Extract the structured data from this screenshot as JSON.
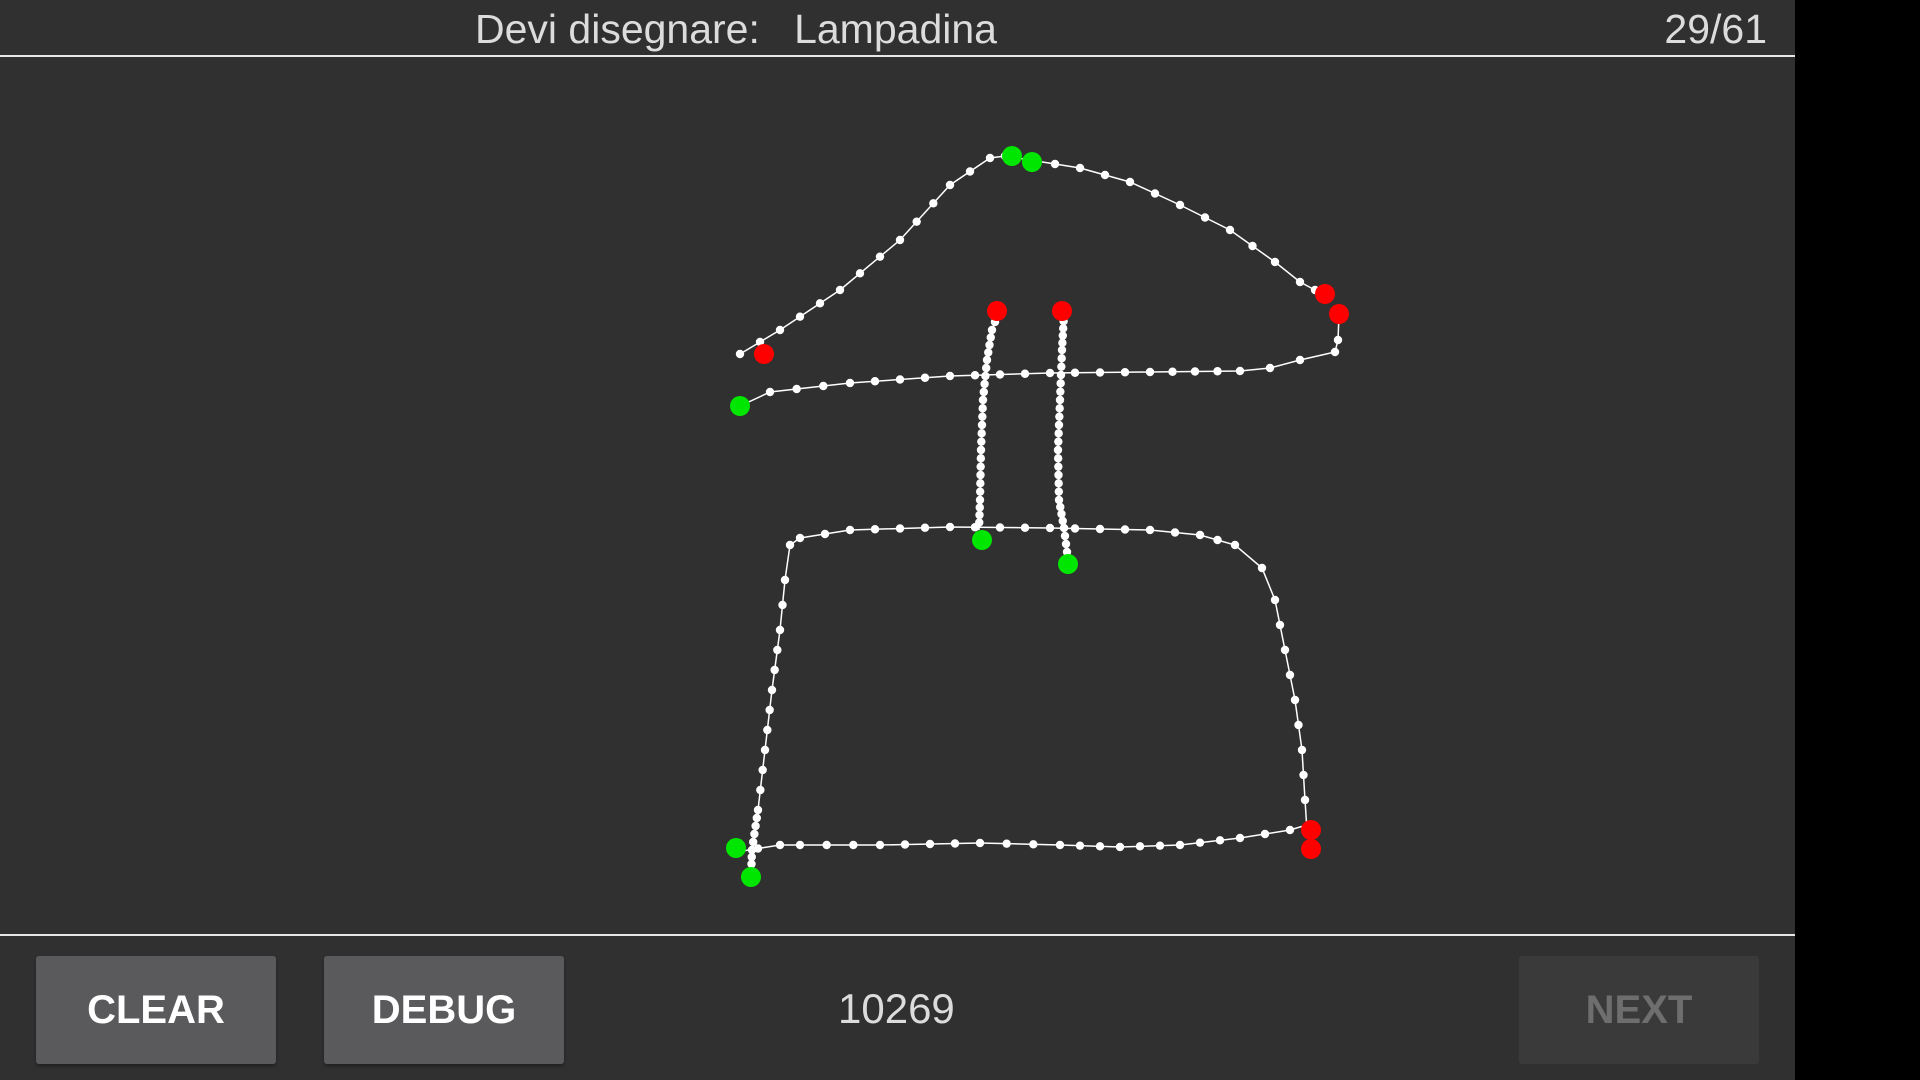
{
  "header": {
    "prompt_label": "Devi disegnare:",
    "prompt_word": "Lampadina",
    "progress": "29/61"
  },
  "footer": {
    "clear_label": "CLEAR",
    "debug_label": "DEBUG",
    "score": "10269",
    "next_label": "NEXT"
  },
  "colors": {
    "background": "#303030",
    "stroke": "#ffffff",
    "stroke_start": "#00e600",
    "stroke_end": "#ff0000",
    "button": "#5a5a5c",
    "button_disabled": "#3a3a3a"
  }
}
